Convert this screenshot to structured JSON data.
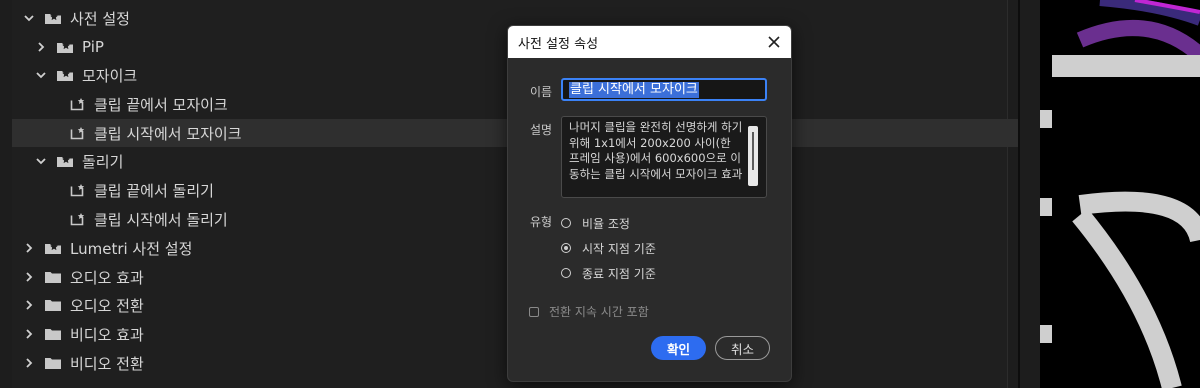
{
  "tree": {
    "items": [
      {
        "label": "사전 설정",
        "kind": "preset-folder",
        "expanded": true,
        "selected": false
      },
      {
        "label": "PiP",
        "kind": "preset-folder",
        "expanded": false,
        "selected": false
      },
      {
        "label": "모자이크",
        "kind": "preset-folder",
        "expanded": true,
        "selected": false
      },
      {
        "label": "클립 끝에서 모자이크",
        "kind": "preset",
        "selected": false
      },
      {
        "label": "클립 시작에서 모자이크",
        "kind": "preset",
        "selected": true
      },
      {
        "label": "돌리기",
        "kind": "preset-folder",
        "expanded": true,
        "selected": false
      },
      {
        "label": "클립 끝에서 돌리기",
        "kind": "preset",
        "selected": false
      },
      {
        "label": "클립 시작에서 돌리기",
        "kind": "preset",
        "selected": false
      },
      {
        "label": "Lumetri 사전 설정",
        "kind": "preset-folder",
        "expanded": false,
        "selected": false
      },
      {
        "label": "오디오 효과",
        "kind": "folder",
        "expanded": false,
        "selected": false
      },
      {
        "label": "오디오 전환",
        "kind": "folder",
        "expanded": false,
        "selected": false
      },
      {
        "label": "비디오 효과",
        "kind": "folder",
        "expanded": false,
        "selected": false
      },
      {
        "label": "비디오 전환",
        "kind": "folder",
        "expanded": false,
        "selected": false
      }
    ]
  },
  "dialog": {
    "title": "사전 설정 속성",
    "name_label": "이름",
    "name_value": "클립 시작에서 모자이크",
    "description_label": "설명",
    "description_value": "나머지 클립을 완전히 선명하게 하기 위해 1x1에서 200x200 사이(한 프레임 사용)에서 600x600으로 이동하는 클립 시작에서 모자이크 효과",
    "type_label": "유형",
    "type_options": [
      {
        "label": "비율 조정",
        "checked": false
      },
      {
        "label": "시작 지점 기준",
        "checked": true
      },
      {
        "label": "종료 지점 기준",
        "checked": false
      }
    ],
    "include_duration_label": "전환 지속 시간 포함",
    "include_duration_checked": false,
    "ok_label": "확인",
    "cancel_label": "취소"
  },
  "colors": {
    "accent": "#2d6cf0",
    "selection": "#3b6fd8",
    "panel_bg": "#1f1f1f",
    "dialog_bg": "#2b2b2b"
  },
  "icons": {
    "expanded": "chevron-down-icon",
    "collapsed": "chevron-right-icon",
    "preset_folder": "preset-folder-icon",
    "folder": "folder-icon",
    "preset": "preset-icon",
    "close": "close-icon"
  }
}
